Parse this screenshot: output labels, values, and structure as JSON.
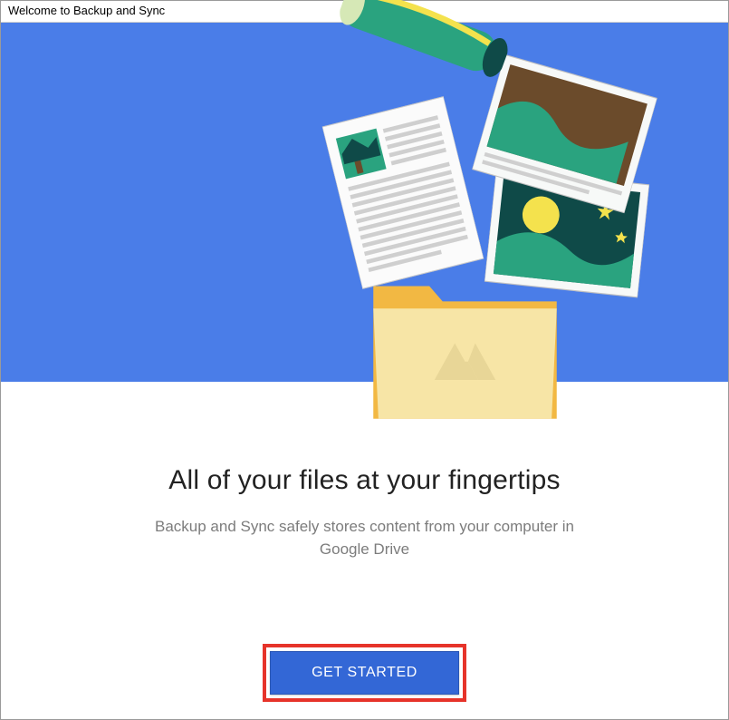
{
  "window": {
    "title": "Welcome to Backup and Sync"
  },
  "hero": {
    "main_headline": "All of your files at your fingertips",
    "sub_headline": "Backup and Sync safely stores content from your computer in Google Drive"
  },
  "actions": {
    "primary_label": "GET STARTED"
  },
  "colors": {
    "hero_bg": "#4a7de8",
    "button_bg": "#3367d6",
    "highlight_box": "#e6332a"
  }
}
